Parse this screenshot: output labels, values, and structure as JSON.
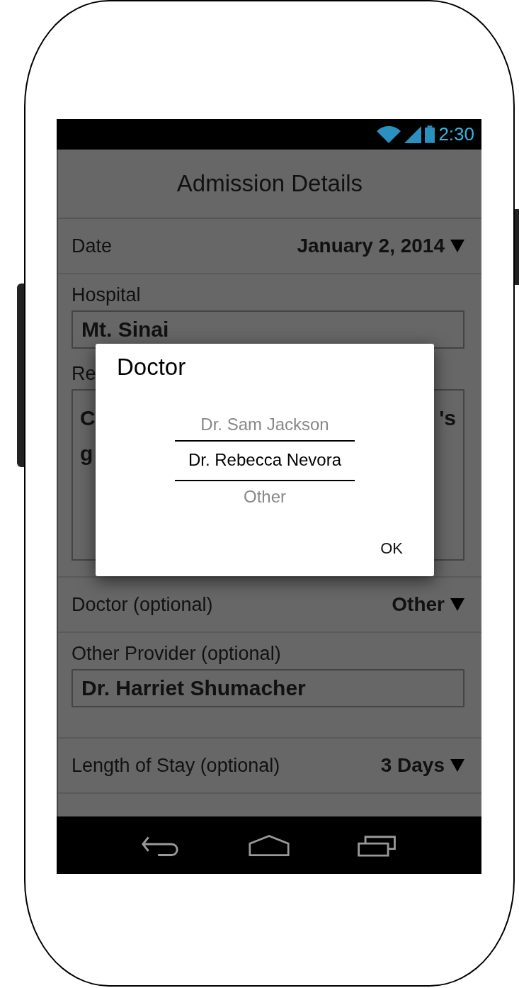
{
  "status_bar": {
    "time": "2:30"
  },
  "title": "Admission Details",
  "fields": [
    {
      "kind": "dropdown",
      "label": "Date",
      "value": "January 2, 2014"
    },
    {
      "kind": "text",
      "label": "Hospital",
      "value": "Mt. Sinai"
    },
    {
      "kind": "textarea",
      "label": "Re",
      "lines": [
        {
          "left": "C",
          "right": "'s"
        },
        {
          "left": "g"
        }
      ]
    },
    {
      "kind": "dropdown",
      "label": "Doctor (optional)",
      "value": "Other"
    },
    {
      "kind": "text",
      "label": "Other Provider (optional)",
      "value": "Dr. Harriet Shumacher"
    },
    {
      "kind": "dropdown",
      "label": "Length of Stay (optional)",
      "value": "3 Days"
    }
  ],
  "dialog": {
    "title": "Doctor",
    "options": [
      {
        "label": "Dr. Sam Jackson",
        "selected": false
      },
      {
        "label": "Dr. Rebecca Nevora",
        "selected": true
      },
      {
        "label": "Other",
        "selected": false
      }
    ],
    "button": "OK"
  }
}
